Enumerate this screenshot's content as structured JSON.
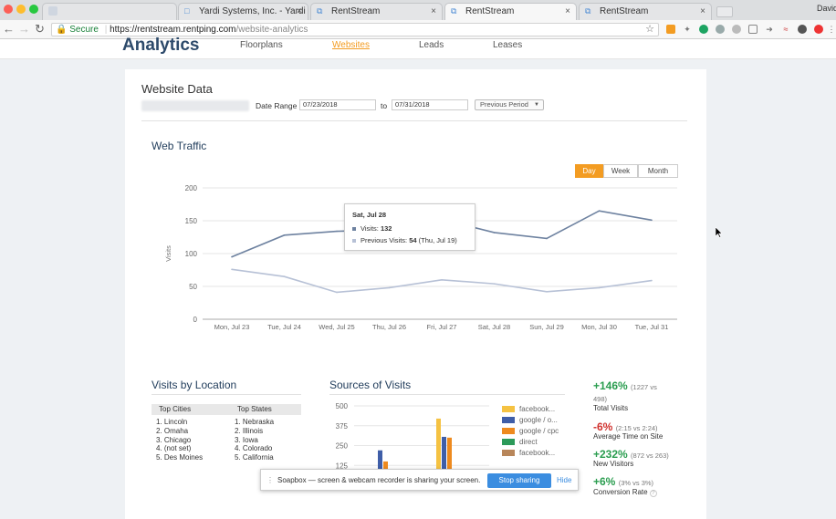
{
  "browser": {
    "tabs": [
      {
        "title": ""
      },
      {
        "title": "Yardi Systems, Inc. - Yardi Vo"
      },
      {
        "title": "RentStream"
      },
      {
        "title": "RentStream"
      },
      {
        "title": "RentStream"
      }
    ],
    "user": "David",
    "secure_label": "Secure",
    "url_host": "https://rentstream.rentping.com",
    "url_path": "/website-analytics"
  },
  "header": {
    "brand": "Analytics",
    "nav": [
      "Floorplans",
      "Websites",
      "Leads",
      "Leases"
    ],
    "active_nav": "Websites"
  },
  "website_data": {
    "title": "Website Data",
    "date_range_label": "Date Range",
    "from": "07/23/2018",
    "to_label": "to",
    "to": "07/31/2018",
    "compare": "Previous Period"
  },
  "web_traffic": {
    "title": "Web Traffic",
    "toggles": [
      "Day",
      "Week",
      "Month"
    ],
    "active_toggle": "Day",
    "tooltip": {
      "title": "Sat, Jul 28",
      "visits_label": "Visits:",
      "visits_value": "132",
      "prev_label": "Previous Visits:",
      "prev_value": "54",
      "prev_note": "(Thu, Jul 19)"
    }
  },
  "chart_data": [
    {
      "type": "line",
      "x": [
        "Mon, Jul 23",
        "Tue, Jul 24",
        "Wed, Jul 25",
        "Thu, Jul 26",
        "Fri, Jul 27",
        "Sat, Jul 28",
        "Sun, Jul 29",
        "Mon, Jul 30",
        "Tue, Jul 31"
      ],
      "series": [
        {
          "values": [
            95,
            128,
            134,
            136,
            152,
            132,
            123,
            165,
            151
          ],
          "color": "#6e82a0"
        },
        {
          "values": [
            76,
            65,
            41,
            48,
            60,
            54,
            42,
            48,
            59
          ],
          "color": "#b7c1d6"
        }
      ],
      "ylabel": "Visits",
      "yticks": [
        0,
        50,
        100,
        150,
        200
      ],
      "ylim": [
        0,
        200
      ]
    },
    {
      "type": "bar",
      "title": "Sources of Visits",
      "yticks": [
        125,
        250,
        375,
        500
      ],
      "ylim": [
        0,
        500
      ],
      "series": [
        {
          "name": "facebook...",
          "color": "#f5c242",
          "values": [
            0,
            0,
            0,
            420
          ]
        },
        {
          "name": "google / o...",
          "color": "#3f5ea8",
          "values": [
            0,
            220,
            0,
            305
          ]
        },
        {
          "name": "google / cpc",
          "color": "#ee8a1e",
          "values": [
            0,
            150,
            0,
            300
          ]
        },
        {
          "name": "direct",
          "color": "#2c9a5a",
          "values": [
            0,
            0,
            0,
            0
          ]
        },
        {
          "name": "facebook...",
          "color": "#b8865a",
          "values": [
            0,
            0,
            0,
            0
          ]
        }
      ]
    }
  ],
  "location": {
    "title": "Visits by Location",
    "col_cities": "Top Cities",
    "col_states": "Top States",
    "cities": [
      "1. Lincoln",
      "2. Omaha",
      "3. Chicago",
      "4. (not set)",
      "5. Des Moines"
    ],
    "states": [
      "1. Nebraska",
      "2. Illinois",
      "3. Iowa",
      "4. Colorado",
      "5. California"
    ]
  },
  "stats": [
    {
      "value": "+146%",
      "detail": "(1227 vs",
      "detail2": "498)",
      "label": "Total Visits",
      "color": "#2a9d4f"
    },
    {
      "value": "-6%",
      "detail": "(2:15 vs 2:24)",
      "label": "Average Time on Site",
      "color": "#d0312d"
    },
    {
      "value": "+232%",
      "detail": "(872 vs 263)",
      "label": "New Visitors",
      "color": "#2a9d4f"
    },
    {
      "value": "+6%",
      "detail": "(3% vs 3%)",
      "label": "Conversion Rate",
      "color": "#2a9d4f"
    }
  ],
  "soapbox": {
    "message": "Soapbox — screen & webcam recorder is sharing your screen.",
    "stop": "Stop sharing",
    "hide": "Hide"
  },
  "icons": [
    "back-icon",
    "forward-icon",
    "reload-icon",
    "lock-icon",
    "star-icon"
  ]
}
